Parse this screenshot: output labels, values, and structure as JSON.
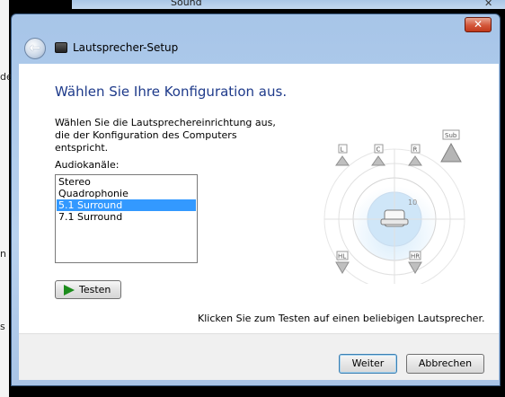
{
  "background_window": {
    "title": "Sound",
    "close_glyph": "✕"
  },
  "left_partial_text": [
    "der",
    "n",
    "s"
  ],
  "dialog": {
    "close_glyph": "✕",
    "back_glyph": "←",
    "title": "Lautsprecher-Setup",
    "heading": "Wählen Sie Ihre Konfiguration aus.",
    "instruction": "Wählen Sie die Lautsprechereinrichtung aus, die der Konfiguration des Computers entspricht.",
    "channels_label": "Audiokanäle:",
    "channel_options": [
      "Stereo",
      "Quadrophonie",
      "5.1 Surround",
      "7.1 Surround"
    ],
    "selected_channel": "5.1 Surround",
    "test_button": "Testen",
    "hint": "Klicken Sie zum Testen auf einen beliebigen Lautsprecher.",
    "next_button": "Weiter",
    "cancel_button": "Abbrechen"
  },
  "speaker_labels": [
    "L",
    "C",
    "R",
    "Sub",
    "HL",
    "HR"
  ],
  "colors": {
    "accent": "#3399ff",
    "heading": "#1e3a8a",
    "frame": "#b9d2ef",
    "selection": "#3399ff"
  }
}
